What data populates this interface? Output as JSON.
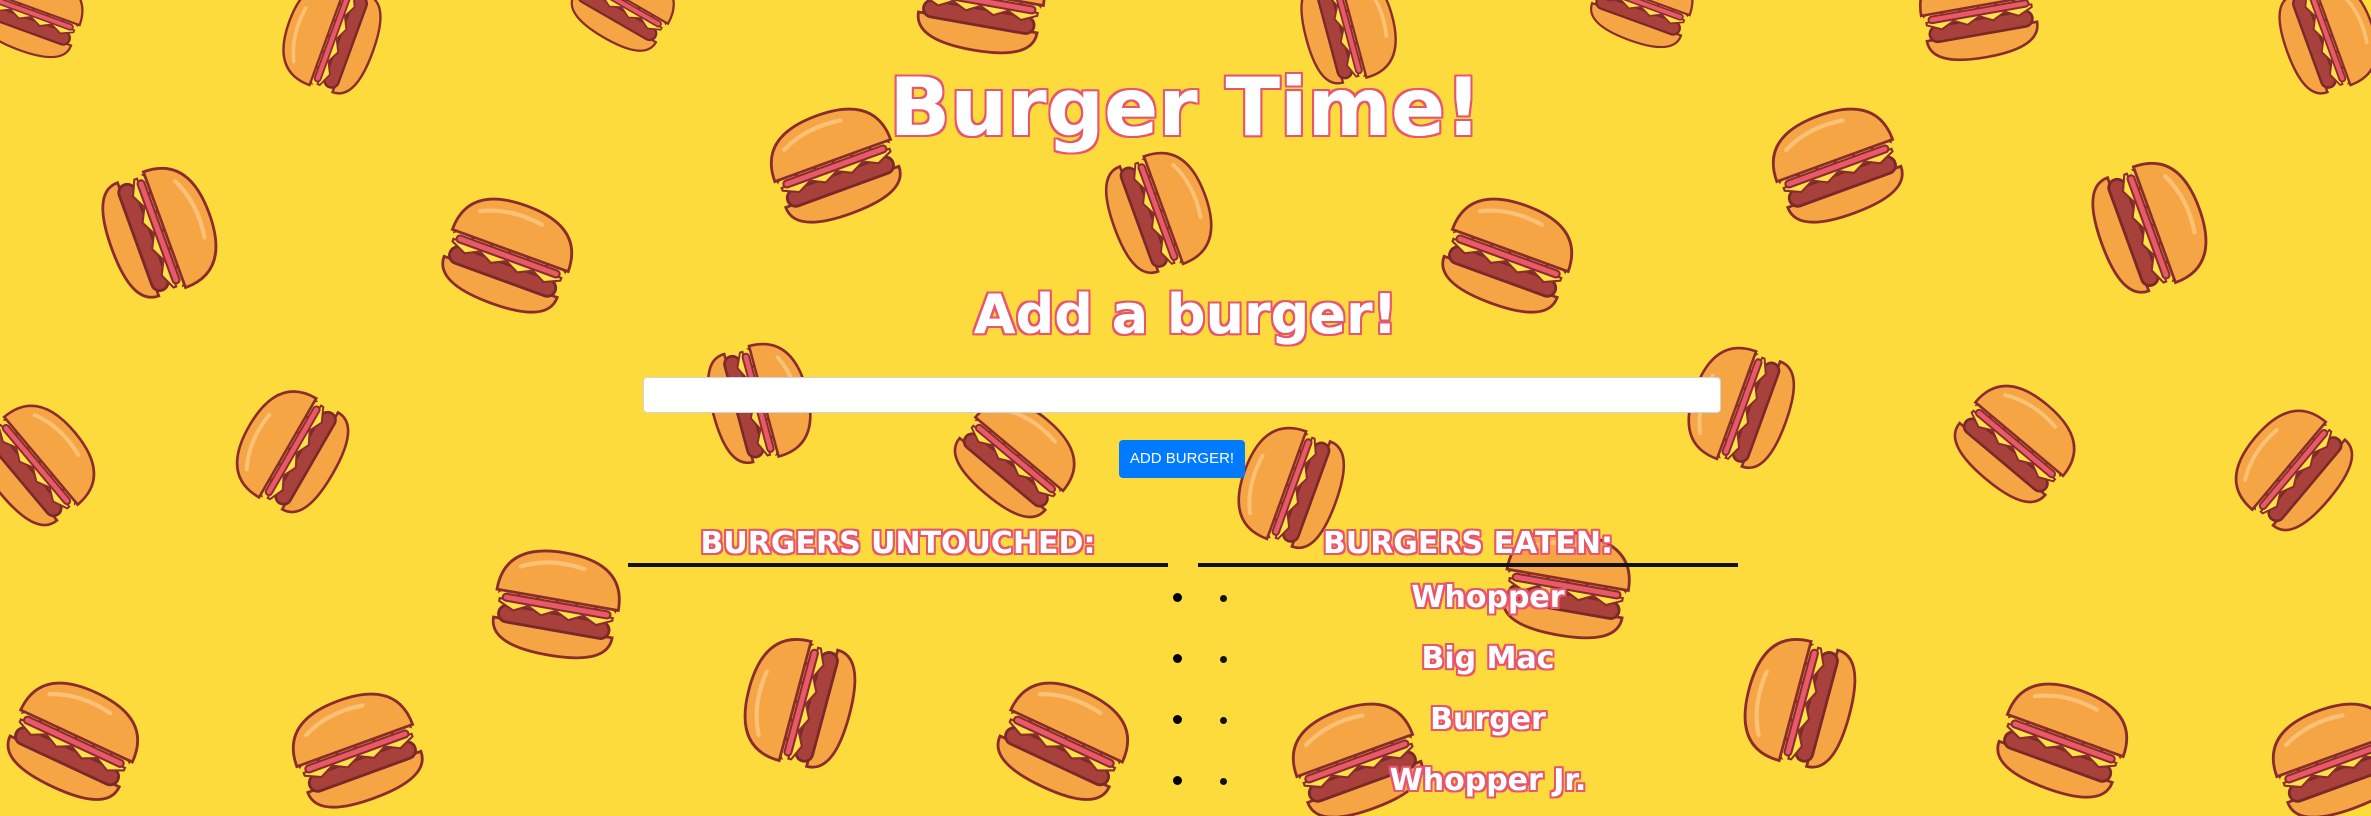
{
  "header": {
    "title": "Burger Time!"
  },
  "add_form": {
    "heading": "Add a burger!",
    "input_value": "",
    "input_placeholder": "",
    "button_label": "ADD BURGER!"
  },
  "untouched": {
    "heading": "BURGERS UNTOUCHED:",
    "items": []
  },
  "eaten": {
    "heading": "BURGERS EATEN:",
    "items": [
      "Whopper",
      "Big Mac",
      "Burger",
      "Whopper Jr."
    ]
  },
  "background": {
    "pattern_icon": "burger-icon",
    "color": "#fedb3d",
    "text_outline_color": "#e8556e",
    "button_color": "#007bff"
  }
}
